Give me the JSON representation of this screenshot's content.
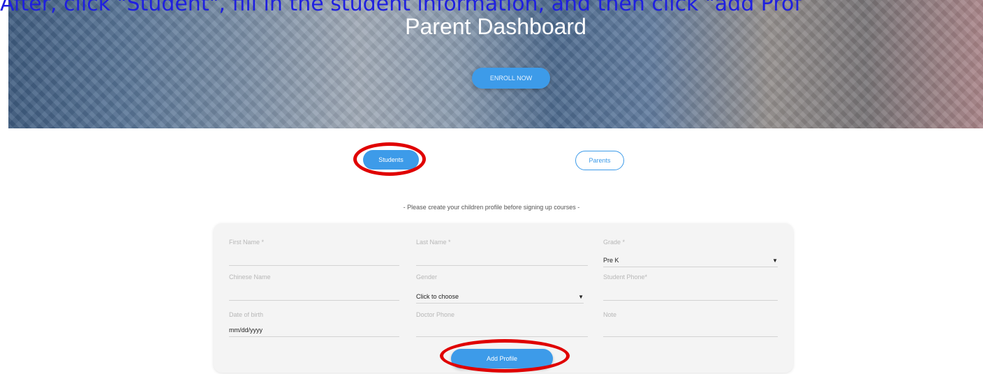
{
  "instruction": "After, click \"Student\", fill in the student information, and then click \"add Prof",
  "hero": {
    "title": "Parent Dashboard",
    "enroll_label": "ENROLL NOW"
  },
  "tabs": {
    "students": "Students",
    "parents": "Parents"
  },
  "notice": "- Please create your children profile before signing up courses -",
  "form": {
    "first_name": "First Name *",
    "last_name": "Last Name *",
    "grade": {
      "label": "Grade *",
      "value": "Pre K"
    },
    "chinese_name": "Chinese Name",
    "gender": {
      "label": "Gender",
      "value": "Click to choose"
    },
    "student_phone": "Student Phone*",
    "date_of_birth": {
      "label": "Date of birth",
      "value": "mm/dd/yyyy"
    },
    "doctor_phone": "Doctor Phone",
    "note": "Note",
    "add_profile_label": "Add Profile"
  },
  "colors": {
    "accent": "#3d9be9",
    "annotation": "#e00000",
    "instruction_text": "#1f1fe0"
  },
  "icons": {
    "dropdown_arrow": "caret-down-icon"
  }
}
